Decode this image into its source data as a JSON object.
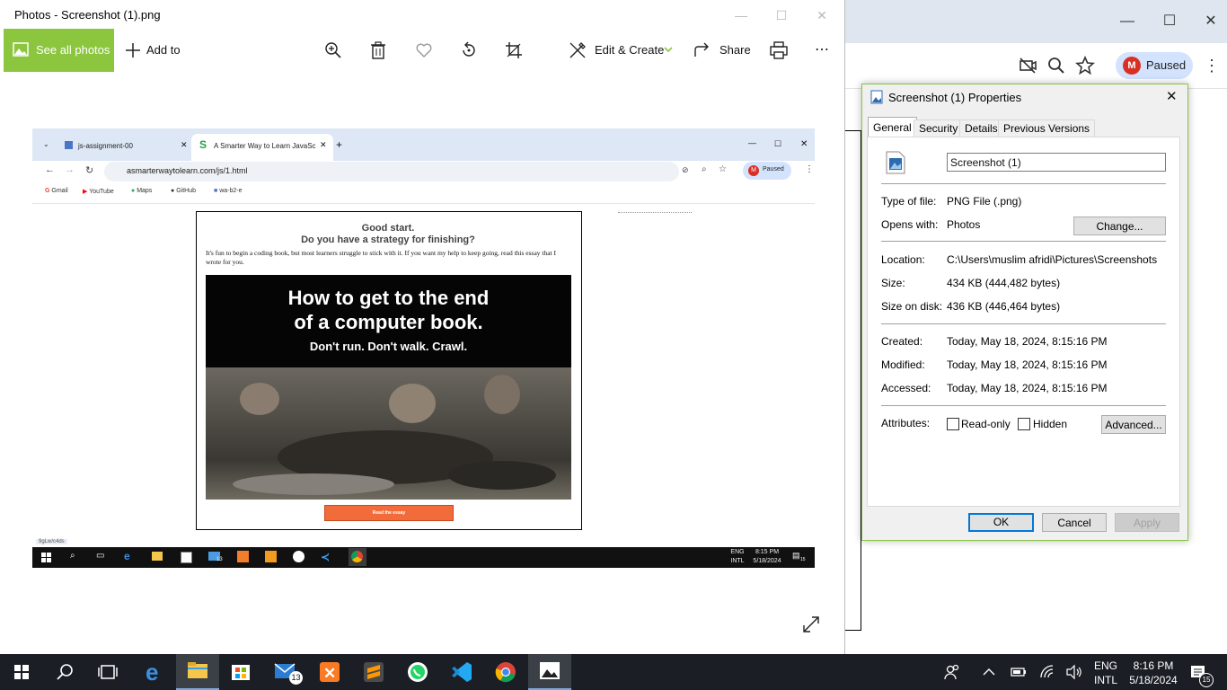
{
  "chrome_bg": {
    "profile_initial": "M",
    "profile_label": "Paused"
  },
  "photos": {
    "title": "Photos - Screenshot (1).png",
    "see_all": "See all photos",
    "add_to": "Add to",
    "edit_create": "Edit & Create",
    "share": "Share"
  },
  "screenshot": {
    "tab1": "js-assignment-00",
    "tab2": "A Smarter Way to Learn JavaSc",
    "url": "asmarterwaytolearn.com/js/1.html",
    "profile_label": "Paused",
    "bookmarks": [
      "Gmail",
      "YouTube",
      "Maps",
      "GitHub",
      "wa-b2-e"
    ],
    "heading1": "Good start.",
    "heading2": "Do you have a strategy for finishing?",
    "paragraph": "It's fun to begin a coding book, but most learners struggle to stick with it. If you want my help to keep going, read this essay that I wrote for you.",
    "banner_line1": "How to get to the end",
    "banner_line2": "of a computer book.",
    "banner_sub": "Don't run. Don't walk. Crawl.",
    "cta": "Read the essay",
    "status_url": "9gLw/c4ds",
    "lang1": "ENG",
    "lang2": "INTL",
    "time": "8:15 PM",
    "date": "5/18/2024",
    "mail_badge": "13",
    "notif_badge": "15"
  },
  "properties": {
    "title": "Screenshot (1) Properties",
    "tabs": [
      "General",
      "Security",
      "Details",
      "Previous Versions"
    ],
    "filename": "Screenshot (1)",
    "type_label": "Type of file:",
    "type_value": "PNG File (.png)",
    "opens_label": "Opens with:",
    "opens_value": "Photos",
    "change_btn": "Change...",
    "location_label": "Location:",
    "location_value": "C:\\Users\\muslim afridi\\Pictures\\Screenshots",
    "size_label": "Size:",
    "size_value": "434 KB (444,482 bytes)",
    "disk_label": "Size on disk:",
    "disk_value": "436 KB (446,464 bytes)",
    "created_label": "Created:",
    "created_value": "Today, May 18, 2024, 8:15:16 PM",
    "modified_label": "Modified:",
    "modified_value": "Today, May 18, 2024, 8:15:16 PM",
    "accessed_label": "Accessed:",
    "accessed_value": "Today, May 18, 2024, 8:15:16 PM",
    "attributes_label": "Attributes:",
    "readonly_label": "Read-only",
    "hidden_label": "Hidden",
    "advanced_btn": "Advanced...",
    "ok": "OK",
    "cancel": "Cancel",
    "apply": "Apply"
  },
  "taskbar": {
    "mail_badge": "13",
    "lang1": "ENG",
    "lang2": "INTL",
    "time": "8:16 PM",
    "date": "5/18/2024",
    "notif_badge": "15"
  },
  "colors": {
    "photos_accent": "#8cc63f",
    "cta": "#f26b3a",
    "taskbar": "#1b1f25"
  }
}
